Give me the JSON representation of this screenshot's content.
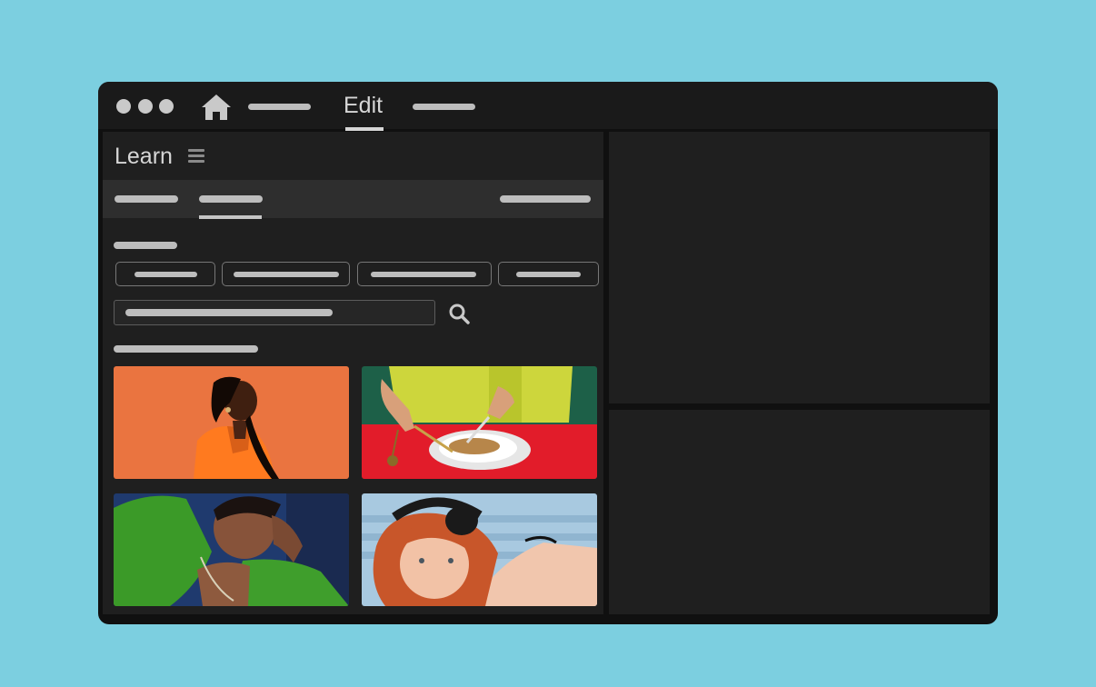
{
  "titlebar": {
    "window_controls": [
      "dot",
      "dot",
      "dot"
    ],
    "home_icon": "home-icon",
    "menu": {
      "edit_label": "Edit"
    }
  },
  "panel": {
    "title": "Learn",
    "menu_icon": "hamburger-icon",
    "search_icon": "search-icon",
    "thumbnails": [
      {
        "name": "woman-orange-background"
      },
      {
        "name": "hands-cutting-food-red-table"
      },
      {
        "name": "man-green-jacket"
      },
      {
        "name": "redhead-woman-headphones"
      }
    ]
  },
  "colors": {
    "page_background": "#7ccfe0",
    "window_background": "#101010",
    "panel_background": "#1f1f1f",
    "placeholder_bar": "#bdbdbd"
  }
}
